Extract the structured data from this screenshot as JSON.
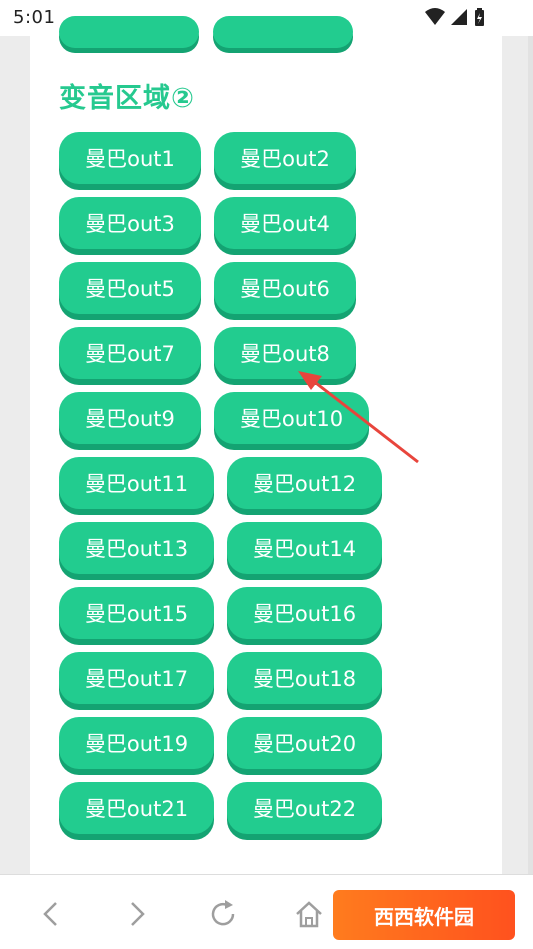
{
  "status_bar": {
    "time": "5:01"
  },
  "section": {
    "title": "变音区域②"
  },
  "buttons": [
    {
      "label": "曼巴out1"
    },
    {
      "label": "曼巴out2"
    },
    {
      "label": "曼巴out3"
    },
    {
      "label": "曼巴out4"
    },
    {
      "label": "曼巴out5"
    },
    {
      "label": "曼巴out6"
    },
    {
      "label": "曼巴out7"
    },
    {
      "label": "曼巴out8"
    },
    {
      "label": "曼巴out9"
    },
    {
      "label": "曼巴out10"
    },
    {
      "label": "曼巴out11"
    },
    {
      "label": "曼巴out12"
    },
    {
      "label": "曼巴out13"
    },
    {
      "label": "曼巴out14"
    },
    {
      "label": "曼巴out15"
    },
    {
      "label": "曼巴out16"
    },
    {
      "label": "曼巴out17"
    },
    {
      "label": "曼巴out18"
    },
    {
      "label": "曼巴out19"
    },
    {
      "label": "曼巴out20"
    },
    {
      "label": "曼巴out21"
    },
    {
      "label": "曼巴out22"
    }
  ],
  "watermark": {
    "text": "西西软件园"
  },
  "colors": {
    "accent": "#22cc8f",
    "accent_shadow": "#14a372",
    "annotation": "#e8453c"
  },
  "nav_icons": [
    "back-icon",
    "forward-icon",
    "reload-icon",
    "home-icon"
  ]
}
